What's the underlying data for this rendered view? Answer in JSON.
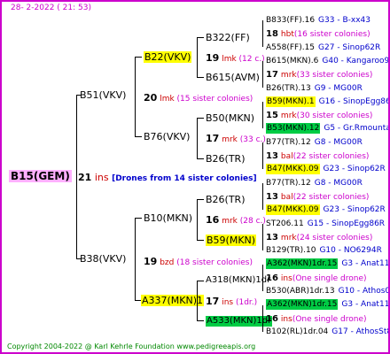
{
  "header": {
    "date": "28-  2-2022 ( 21: 53)"
  },
  "footer": {
    "copyright": "Copyright 2004-2022 @ Karl Kehrle Foundation   www.pedigreeapis.org"
  },
  "root": {
    "name": "B15(GEM)",
    "num": "21",
    "ins": "ins",
    "note": "[Drones from 14 sister colonies]"
  },
  "g1": {
    "top": {
      "name": "B51(VKV)",
      "num": "20",
      "ins": "lmk",
      "note": "(15 sister colonies)"
    },
    "bot": {
      "name": "B38(VKV)",
      "num": "19",
      "ins": "bzd",
      "note": "(18 sister colonies)"
    }
  },
  "g2": [
    {
      "name": "B22(VKV)",
      "num": "19",
      "ins": "lmk",
      "note": "(12 c.)"
    },
    {
      "name": "B76(VKV)",
      "num": "17",
      "ins": "mrk",
      "note": "(33 c.)"
    },
    {
      "name": "B10(MKN)",
      "num": "16",
      "ins": "mrk",
      "note": "(28 c.)"
    },
    {
      "name": "A337(MKN)1",
      "num": "17",
      "ins": "ins",
      "note": "(1dr.)"
    }
  ],
  "g3": [
    {
      "name": "B322(FF)",
      "num": "",
      "ins": "",
      "note": ""
    },
    {
      "name": "B615(AVM)",
      "num": "",
      "ins": "",
      "note": ""
    },
    {
      "name": "B50(MKN)",
      "num": "",
      "ins": "",
      "note": ""
    },
    {
      "name": "B26(TR)",
      "num": "",
      "ins": "",
      "note": ""
    },
    {
      "name": "B26(TR)",
      "num": "",
      "ins": "",
      "note": ""
    },
    {
      "name": "B59(MKN)",
      "num": "",
      "ins": "",
      "note": ""
    },
    {
      "name": "A318(MKN)1dr",
      "num": "",
      "ins": "",
      "note": ""
    },
    {
      "name": "A533(MKN)1dr",
      "num": "",
      "ins": "",
      "note": ""
    }
  ],
  "g4": [
    {
      "name": "B833(FF).16",
      "code": "G33 - B-xx43"
    },
    {
      "num": "18",
      "ins": "hbt",
      "note": "(16 sister colonies)"
    },
    {
      "name": "A558(FF).15",
      "code": "G27 - Sinop62R"
    },
    {
      "name": "B615(MKN).6",
      "code": "G40 - Kangaroo98R"
    },
    {
      "num": "17",
      "ins": "mrk",
      "note": "(33 sister colonies)"
    },
    {
      "name": "B26(TR).13",
      "code": "G9 - MG00R"
    },
    {
      "name": "B59(MKN).1",
      "code": "G16 - SinopEgg86R"
    },
    {
      "num": "15",
      "ins": "mrk",
      "note": "(30 sister colonies)"
    },
    {
      "name": "B53(MKN).12",
      "code": "G5 - Gr.Rmounta"
    },
    {
      "name": "B77(TR).12",
      "code": "G8 - MG00R"
    },
    {
      "num": "13",
      "ins": "bal",
      "note": "(22 sister colonies)"
    },
    {
      "name": "B47(MKK).09",
      "code": "G23 - Sinop62R"
    },
    {
      "name": "B77(TR).12",
      "code": "G8 - MG00R"
    },
    {
      "num": "13",
      "ins": "bal",
      "note": "(22 sister colonies)"
    },
    {
      "name": "B47(MKK).09",
      "code": "G23 - Sinop62R"
    },
    {
      "name": "ST206.11",
      "code": "G15 - SinopEgg86R"
    },
    {
      "num": "13",
      "ins": "mrk",
      "note": "(24 sister colonies)"
    },
    {
      "name": "B129(TR).10",
      "code": "G10 - NO6294R"
    },
    {
      "name": "A362(MKN)1dr.15",
      "code": "G3 - Anat11Q"
    },
    {
      "num": "16",
      "ins": "ins",
      "note": "(One single drone)"
    },
    {
      "name": "B530(ABR)1dr.13",
      "code": "G10 - Athos00R"
    },
    {
      "name": "A362(MKN)1dr.15",
      "code": "G3 - Anat11Q"
    },
    {
      "num": "16",
      "ins": "ins",
      "note": "(One single drone)"
    },
    {
      "name": "B102(RL)1dr.04",
      "code": "G17 - AthosSt80R"
    }
  ],
  "colors": {
    "frame": "#cc00cc",
    "root_bg": "#ffb0ff",
    "yellow": "#ffff00",
    "green": "#00cc44",
    "copyright": "#008800"
  }
}
